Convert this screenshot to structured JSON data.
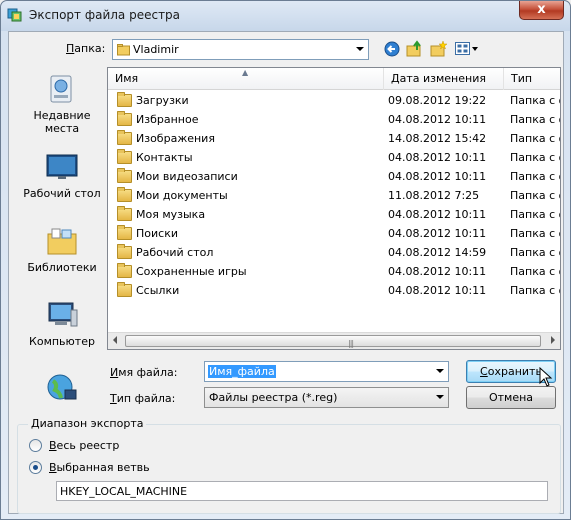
{
  "window": {
    "title": "Экспорт файла реестра",
    "close_glyph": "x"
  },
  "toolbar": {
    "folder_label_pre": "",
    "folder_label_u": "П",
    "folder_label_post": "апка:",
    "current_folder": "Vladimir",
    "icons": [
      "back-arrow-icon",
      "up-folder-icon",
      "new-folder-icon",
      "views-menu-icon"
    ]
  },
  "places": [
    {
      "name": "recent",
      "label": "Недавние места",
      "icon": "recent-places-icon"
    },
    {
      "name": "desktop",
      "label": "Рабочий стол",
      "icon": "desktop-icon"
    },
    {
      "name": "libraries",
      "label": "Библиотеки",
      "icon": "libraries-icon"
    },
    {
      "name": "computer",
      "label": "Компьютер",
      "icon": "computer-icon"
    },
    {
      "name": "network",
      "label": "",
      "icon": "network-icon"
    }
  ],
  "file_list": {
    "columns": [
      "Имя",
      "Дата изменения",
      "Тип"
    ],
    "rows": [
      {
        "name": "Загрузки",
        "date": "09.08.2012 19:22",
        "type": "Папка с ф"
      },
      {
        "name": "Избранное",
        "date": "04.08.2012 10:11",
        "type": "Папка с ф"
      },
      {
        "name": "Изображения",
        "date": "14.08.2012 15:42",
        "type": "Папка с ф"
      },
      {
        "name": "Контакты",
        "date": "04.08.2012 10:11",
        "type": "Папка с ф"
      },
      {
        "name": "Мои видеозаписи",
        "date": "04.08.2012 10:11",
        "type": "Папка с ф"
      },
      {
        "name": "Мои документы",
        "date": "11.08.2012 7:25",
        "type": "Папка с ф"
      },
      {
        "name": "Моя музыка",
        "date": "04.08.2012 10:11",
        "type": "Папка с ф"
      },
      {
        "name": "Поиски",
        "date": "04.08.2012 10:11",
        "type": "Папка с ф"
      },
      {
        "name": "Рабочий стол",
        "date": "04.08.2012 14:59",
        "type": "Папка с ф"
      },
      {
        "name": "Сохраненные игры",
        "date": "04.08.2012 10:11",
        "type": "Папка с ф"
      },
      {
        "name": "Ссылки",
        "date": "04.08.2012 10:11",
        "type": "Папка с ф"
      }
    ]
  },
  "filename": {
    "label_u": "И",
    "label_rest": "мя файла:",
    "value": "Имя_файла"
  },
  "filetype": {
    "label_u": "Т",
    "label_rest": "ип файла:",
    "value": "Файлы реестра (*.reg)"
  },
  "buttons": {
    "save_u": "С",
    "save_rest": "охранить",
    "cancel": "Отмена"
  },
  "export_range": {
    "title": "Диапазон экспорта",
    "all_u": "В",
    "all_rest": "есь реестр",
    "branch_u": "В",
    "branch_rest": "ыбранная ветвь",
    "branch_value": "HKEY_LOCAL_MACHINE",
    "selected": "branch"
  }
}
